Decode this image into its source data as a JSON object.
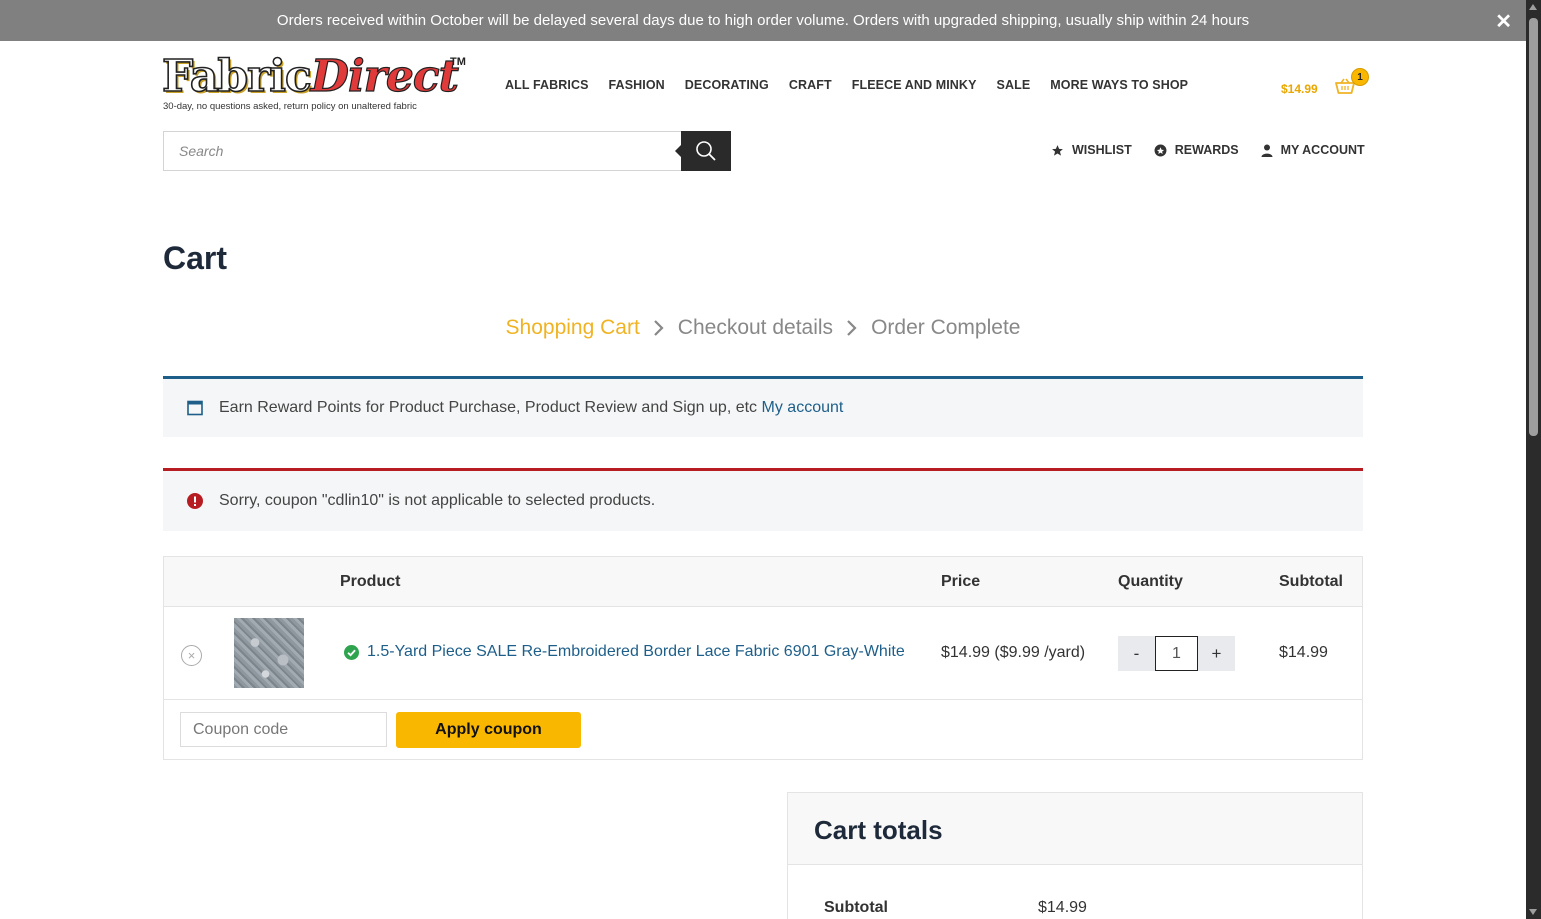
{
  "announcement": {
    "text": "Orders received within October will be delayed several days due to high order volume. Orders with upgraded shipping, usually ship within 24 hours",
    "close": "✕"
  },
  "logo": {
    "brand_part1": "Fabric",
    "brand_part2": "Direct",
    "tm": "TM",
    "tagline": "30-day, no questions asked, return policy on unaltered fabric"
  },
  "nav": {
    "items": [
      "ALL FABRICS",
      "FASHION",
      "DECORATING",
      "CRAFT",
      "FLEECE AND MINKY",
      "SALE",
      "MORE WAYS TO SHOP"
    ]
  },
  "mini_cart": {
    "amount": "$14.99",
    "count": "1"
  },
  "search": {
    "placeholder": "Search"
  },
  "account_nav": {
    "wishlist": "WISHLIST",
    "rewards": "REWARDS",
    "my_account": "MY ACCOUNT"
  },
  "page": {
    "title": "Cart"
  },
  "steps": {
    "step1": "Shopping Cart",
    "step2": "Checkout details",
    "step3": "Order Complete"
  },
  "notices": {
    "info_text": "Earn Reward Points for Product Purchase, Product Review and Sign up, etc",
    "info_link": "My account",
    "error_text": "Sorry, coupon \"cdlin10\" is not applicable to selected products."
  },
  "cart_table": {
    "headers": {
      "product": "Product",
      "price": "Price",
      "quantity": "Quantity",
      "subtotal": "Subtotal"
    },
    "rows": [
      {
        "remove": "×",
        "product_name": "1.5-Yard Piece SALE Re-Embroidered Border Lace Fabric 6901 Gray-White",
        "price": "$14.99 ($9.99 /yard)",
        "qty_minus": "-",
        "quantity": "1",
        "qty_plus": "+",
        "subtotal": "$14.99"
      }
    ],
    "coupon_placeholder": "Coupon code",
    "apply_label": "Apply coupon"
  },
  "totals": {
    "title": "Cart totals",
    "subtotal_label": "Subtotal",
    "subtotal_value": "$14.99"
  },
  "colors": {
    "accent": "#f9b700",
    "link": "#1e5f8a",
    "error": "#b81c23",
    "banner": "#808080",
    "success": "#2ea44f"
  }
}
